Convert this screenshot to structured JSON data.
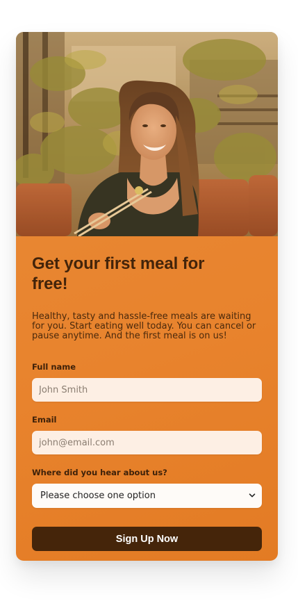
{
  "hero": {
    "title": "Get your first meal for free!",
    "description": "Healthy, tasty and hassle-free meals are waiting for you. Start eating well today. You can cancel or pause anytime. And the first meal is on us!"
  },
  "form": {
    "full_name": {
      "label": "Full name",
      "placeholder": "John Smith"
    },
    "email": {
      "label": "Email",
      "placeholder": "john@email.com"
    },
    "source": {
      "label": "Where did you hear about us?",
      "selected": "Please choose one option"
    },
    "submit_label": "Sign Up Now"
  },
  "colors": {
    "card_orange": "#e8832d",
    "input_bg": "#fdefe4",
    "button_bg": "#45250a",
    "heading": "#43240a"
  },
  "icons": {
    "select_arrow": "chevron-down-icon"
  }
}
